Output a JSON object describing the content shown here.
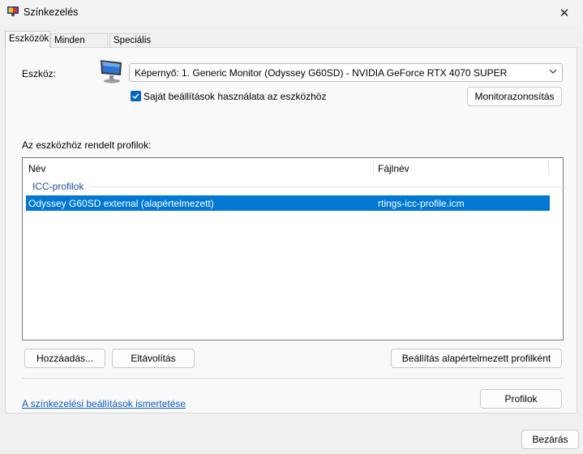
{
  "window": {
    "title": "Színkezelés",
    "close_glyph": "✕"
  },
  "tabs": [
    {
      "label": "Eszközök",
      "active": true
    },
    {
      "label": "Minden profil",
      "active": false
    },
    {
      "label": "Speciális",
      "active": false
    }
  ],
  "device": {
    "label": "Eszköz:",
    "icon": "monitor-icon",
    "selected": "Képernyő: 1. Generic Monitor (Odyssey G60SD) - NVIDIA GeForce RTX 4070 SUPER",
    "use_own_settings_label": "Saját beállítások használata az eszközhöz",
    "use_own_settings_checked": true,
    "identify_button": "Monitorazonosítás"
  },
  "profiles": {
    "section_label": "Az eszközhöz rendelt profilok:",
    "columns": [
      "Név",
      "Fájlnév"
    ],
    "group": "ICC-profilok",
    "rows": [
      {
        "name": "Odyssey G60SD external (alapértelmezett)",
        "file": "rtings-icc-profile.icm",
        "selected": true
      }
    ]
  },
  "buttons": {
    "add": "Hozzáadás...",
    "remove": "Eltávolítás",
    "set_default": "Beállítás alapértelmezett profilként",
    "profiles": "Profilok",
    "close": "Bezárás"
  },
  "link": "A színkezelési beállítások ismertetése",
  "colors": {
    "accent": "#0078d4",
    "checkbox": "#0067c0",
    "link": "#0a5bc4"
  }
}
